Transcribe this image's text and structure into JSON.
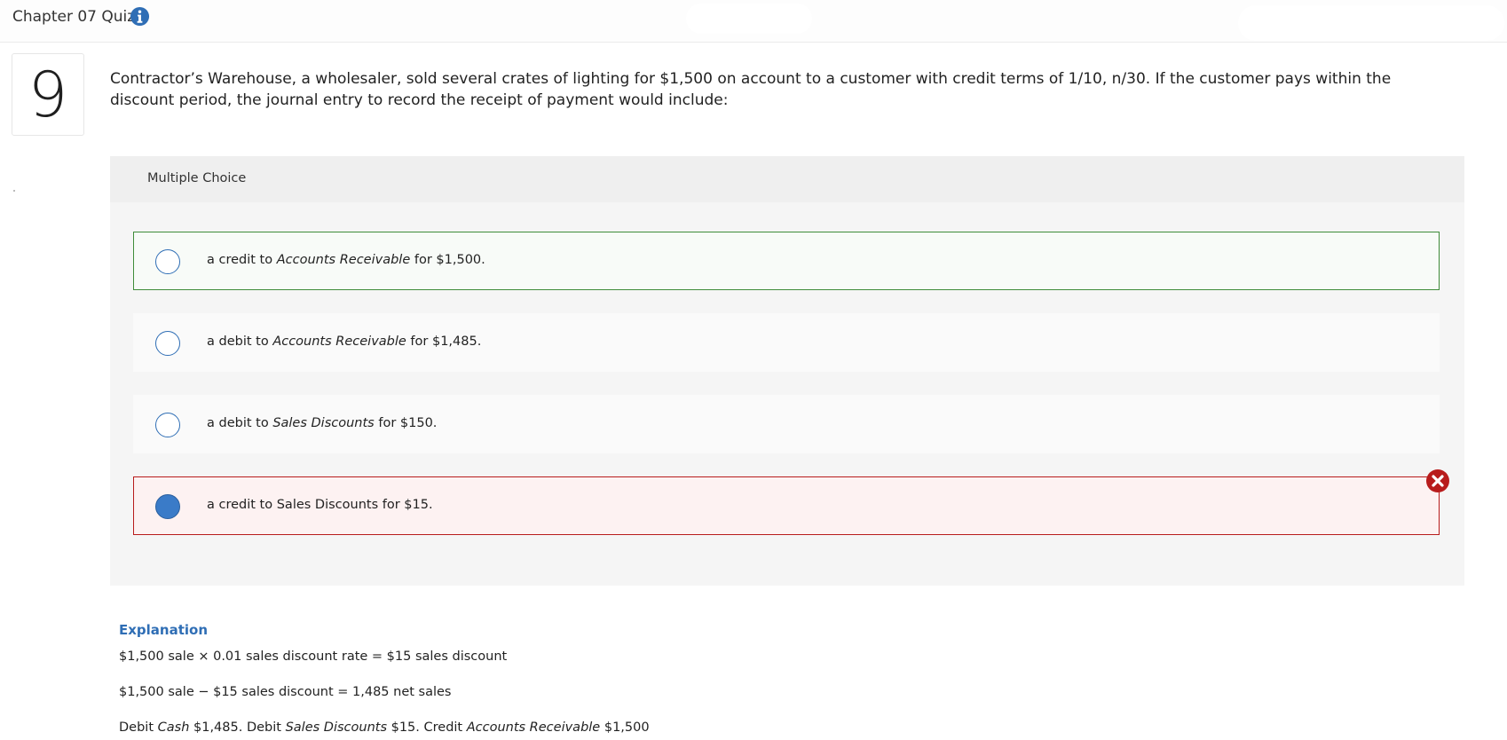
{
  "header": {
    "title": "Chapter 07 Quiz",
    "info_icon": "info-icon"
  },
  "question": {
    "number": "9",
    "text": "Contractor’s Warehouse, a wholesaler, sold several crates of lighting for $1,500 on account to a customer with credit terms of 1/10, n/30. If the customer pays within the discount period, the journal entry to record the receipt of payment would include:"
  },
  "multiple_choice": {
    "label": "Multiple Choice",
    "choices": [
      {
        "pre": "a credit to ",
        "em": "Accounts Receivable",
        "post": " for $1,500.",
        "state": "correct-answer",
        "selected": false
      },
      {
        "pre": "a debit to ",
        "em": "Accounts Receivable",
        "post": " for $1,485.",
        "state": "normal",
        "selected": false
      },
      {
        "pre": "a debit to ",
        "em": "Sales Discounts",
        "post": " for $150.",
        "state": "normal",
        "selected": false
      },
      {
        "pre": "a credit to Sales Discounts for $15.",
        "em": "",
        "post": "",
        "state": "incorrect-selected",
        "selected": true
      }
    ]
  },
  "explanation": {
    "title": "Explanation",
    "line1": "$1,500 sale × 0.01 sales discount rate = $15 sales discount",
    "line2": "$1,500 sale − $15 sales discount = 1,485 net sales",
    "line3": {
      "p1": "Debit ",
      "e1": "Cash",
      "p2": " $1,485. Debit ",
      "e2": "Sales Discounts",
      "p3": " $15. Credit ",
      "e3": "Accounts Receivable",
      "p4": " $1,500"
    }
  },
  "colors": {
    "accent_blue": "#2f6eb5",
    "correct_green": "#3f8c3a",
    "wrong_red": "#b81c1c"
  }
}
